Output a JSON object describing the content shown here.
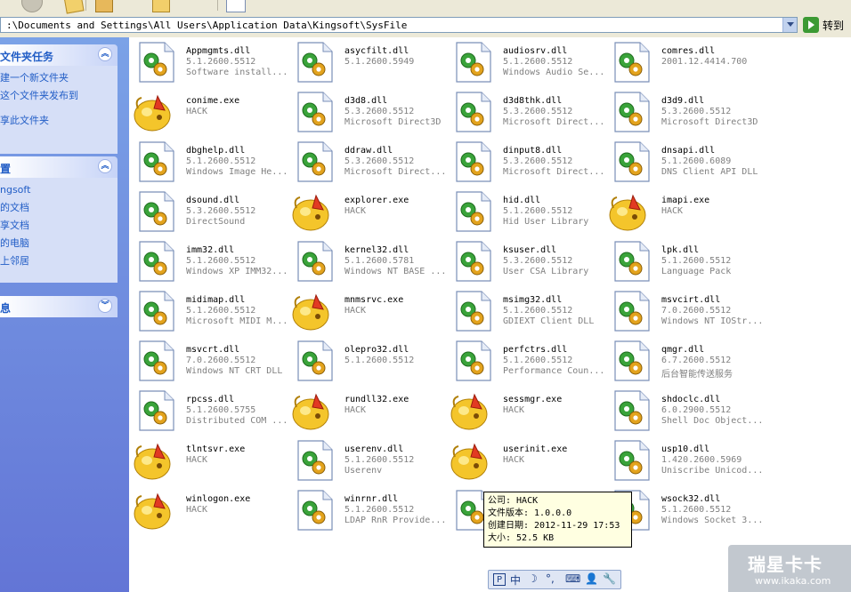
{
  "address_bar": {
    "path": ":\\Documents and Settings\\All Users\\Application Data\\Kingsoft\\SysFile",
    "go_label": "转到"
  },
  "task_pane": {
    "file_tasks": {
      "title": "文件夹任务",
      "links": [
        "建一个新文件夹",
        "这个文件夹发布到",
        "享此文件夹"
      ]
    },
    "other_places": {
      "title": "置",
      "links": [
        "ngsoft",
        "的文档",
        "享文档",
        "的电脑",
        "上邻居"
      ]
    },
    "details": {
      "title": "息"
    }
  },
  "files": [
    {
      "name": "Appmgmts.dll",
      "version": "5.1.2600.5512",
      "desc": "Software install...",
      "icon": "dll-gear-icon"
    },
    {
      "name": "asycfilt.dll",
      "version": "5.1.2600.5949",
      "desc": "",
      "icon": "dll-gear-icon"
    },
    {
      "name": "audiosrv.dll",
      "version": "5.1.2600.5512",
      "desc": "Windows Audio Se...",
      "icon": "dll-gear-icon"
    },
    {
      "name": "comres.dll",
      "version": "2001.12.4414.700",
      "desc": "",
      "icon": "dll-gear-icon"
    },
    {
      "name": "conime.exe",
      "version": "HACK",
      "desc": "",
      "icon": "hack-exe-icon"
    },
    {
      "name": "d3d8.dll",
      "version": "5.3.2600.5512",
      "desc": "Microsoft Direct3D",
      "icon": "dll-gear-icon"
    },
    {
      "name": "d3d8thk.dll",
      "version": "5.3.2600.5512",
      "desc": "Microsoft Direct...",
      "icon": "dll-gear-icon"
    },
    {
      "name": "d3d9.dll",
      "version": "5.3.2600.5512",
      "desc": "Microsoft Direct3D",
      "icon": "dll-gear-icon"
    },
    {
      "name": "dbghelp.dll",
      "version": "5.1.2600.5512",
      "desc": "Windows Image He...",
      "icon": "dll-gear-icon"
    },
    {
      "name": "ddraw.dll",
      "version": "5.3.2600.5512",
      "desc": "Microsoft Direct...",
      "icon": "dll-gear-icon"
    },
    {
      "name": "dinput8.dll",
      "version": "5.3.2600.5512",
      "desc": "Microsoft Direct...",
      "icon": "dll-gear-icon"
    },
    {
      "name": "dnsapi.dll",
      "version": "5.1.2600.6089",
      "desc": "DNS Client API DLL",
      "icon": "dll-gear-icon"
    },
    {
      "name": "dsound.dll",
      "version": "5.3.2600.5512",
      "desc": "DirectSound",
      "icon": "dll-gear-icon"
    },
    {
      "name": "explorer.exe",
      "version": "HACK",
      "desc": "",
      "icon": "hack-exe-icon"
    },
    {
      "name": "hid.dll",
      "version": "5.1.2600.5512",
      "desc": "Hid User Library",
      "icon": "dll-gear-icon"
    },
    {
      "name": "imapi.exe",
      "version": "HACK",
      "desc": "",
      "icon": "hack-exe-icon"
    },
    {
      "name": "imm32.dll",
      "version": "5.1.2600.5512",
      "desc": "Windows XP IMM32...",
      "icon": "dll-gear-icon"
    },
    {
      "name": "kernel32.dll",
      "version": "5.1.2600.5781",
      "desc": "Windows NT BASE ...",
      "icon": "dll-gear-icon"
    },
    {
      "name": "ksuser.dll",
      "version": "5.3.2600.5512",
      "desc": "User CSA Library",
      "icon": "dll-gear-icon"
    },
    {
      "name": "lpk.dll",
      "version": "5.1.2600.5512",
      "desc": "Language Pack",
      "icon": "dll-gear-icon"
    },
    {
      "name": "midimap.dll",
      "version": "5.1.2600.5512",
      "desc": "Microsoft MIDI M...",
      "icon": "dll-gear-icon"
    },
    {
      "name": "mnmsrvc.exe",
      "version": "HACK",
      "desc": "",
      "icon": "hack-exe-icon"
    },
    {
      "name": "msimg32.dll",
      "version": "5.1.2600.5512",
      "desc": "GDIEXT Client DLL",
      "icon": "dll-gear-icon"
    },
    {
      "name": "msvcirt.dll",
      "version": "7.0.2600.5512",
      "desc": "Windows NT IOStr...",
      "icon": "dll-gear-icon"
    },
    {
      "name": "msvcrt.dll",
      "version": "7.0.2600.5512",
      "desc": "Windows NT CRT DLL",
      "icon": "dll-gear-icon"
    },
    {
      "name": "olepro32.dll",
      "version": "5.1.2600.5512",
      "desc": "",
      "icon": "dll-gear-icon"
    },
    {
      "name": "perfctrs.dll",
      "version": "5.1.2600.5512",
      "desc": "Performance Coun...",
      "icon": "dll-gear-icon"
    },
    {
      "name": "qmgr.dll",
      "version": "6.7.2600.5512",
      "desc": "后台智能传送服务",
      "icon": "dll-gear-icon"
    },
    {
      "name": "rpcss.dll",
      "version": "5.1.2600.5755",
      "desc": "Distributed COM ...",
      "icon": "dll-gear-icon"
    },
    {
      "name": "rundll32.exe",
      "version": "HACK",
      "desc": "",
      "icon": "hack-exe-icon"
    },
    {
      "name": "sessmgr.exe",
      "version": "HACK",
      "desc": "",
      "icon": "hack-exe-icon"
    },
    {
      "name": "shdoclc.dll",
      "version": "6.0.2900.5512",
      "desc": "Shell Doc Object...",
      "icon": "dll-gear-icon"
    },
    {
      "name": "tlntsvr.exe",
      "version": "HACK",
      "desc": "",
      "icon": "hack-exe-icon"
    },
    {
      "name": "userenv.dll",
      "version": "5.1.2600.5512",
      "desc": "Userenv",
      "icon": "dll-gear-icon"
    },
    {
      "name": "userinit.exe",
      "version": "HACK",
      "desc": "",
      "icon": "hack-exe-icon"
    },
    {
      "name": "usp10.dll",
      "version": "1.420.2600.5969",
      "desc": "Uniscribe Unicod...",
      "icon": "dll-gear-icon"
    },
    {
      "name": "winlogon.exe",
      "version": "HACK",
      "desc": "",
      "icon": "hack-exe-icon"
    },
    {
      "name": "winrnr.dll",
      "version": "5.1.2600.5512",
      "desc": "LDAP RnR Provide...",
      "icon": "dll-gear-icon"
    },
    {
      "name": "",
      "version": "",
      "desc": "",
      "icon": "dll-gear-icon"
    },
    {
      "name": "wsock32.dll",
      "version": "5.1.2600.5512",
      "desc": "Windows Socket 3...",
      "icon": "dll-gear-icon"
    }
  ],
  "tooltip": {
    "company": "公司: HACK",
    "file_version": "文件版本: 1.0.0.0",
    "created": "创建日期: 2012-11-29 17:53",
    "size": "大小: 52.5 KB"
  },
  "ime_bar": {
    "items": [
      "P",
      "中",
      "☽",
      "°,",
      "⌨",
      "👤",
      "🔧"
    ]
  },
  "watermark": {
    "line1": "瑞星卡卡",
    "line2": "www.ikaka.com"
  },
  "colors": {
    "task_pane_gradient_top": "#7ba2e7",
    "task_pane_gradient_bottom": "#6375d6",
    "link": "#215dc6",
    "tooltip_bg": "#ffffe1"
  }
}
